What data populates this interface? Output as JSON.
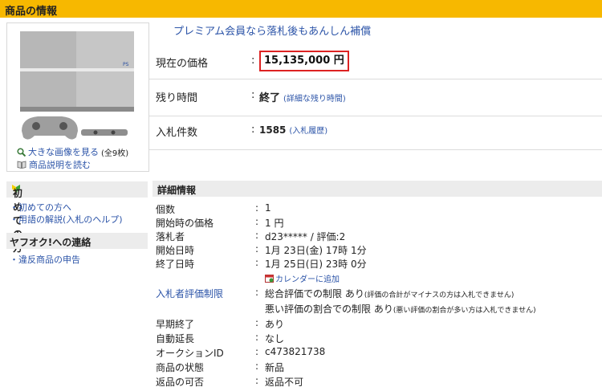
{
  "header": {
    "title": "商品の情報"
  },
  "image_links": {
    "large": "大きな画像を見る",
    "large_count": "(全9枚)",
    "desc": "商品説明を読む"
  },
  "premium": "プレミアム会員なら落札後もあんしん補償",
  "price": {
    "label": "現在の価格",
    "value": "15,135,000 円"
  },
  "time": {
    "label": "残り時間",
    "value": "終了",
    "link": "(詳細な残り時間)"
  },
  "bids": {
    "label": "入札件数",
    "value": "1585",
    "link": "(入札履歴)"
  },
  "sidebar": {
    "beginner_title": "初めての方",
    "beginner_items": [
      "初めての方へ",
      "用語の解説(入札のヘルプ)"
    ],
    "contact_title": "ヤフオク!への連絡",
    "contact_items": [
      "違反商品の申告"
    ]
  },
  "details": {
    "title": "詳細情報",
    "rows": [
      {
        "label": "個数",
        "value": "1"
      },
      {
        "label": "開始時の価格",
        "value": "1 円"
      },
      {
        "label": "落札者",
        "value": "d23***** / 評価:2"
      },
      {
        "label": "開始日時",
        "value": "1月 23日(金) 17時 1分"
      },
      {
        "label": "終了日時",
        "value": "1月 25日(日) 23時 0分"
      }
    ],
    "calendar": "カレンダーに追加",
    "restrict": {
      "label": "入札者評価制限",
      "line1": "総合評価での制限 あり",
      "note1": "(評価の合計がマイナスの方は入札できません)",
      "line2": "悪い評価の割合での制限 あり",
      "note2": "(悪い評価の割合が多い方は入札できません)"
    },
    "rows2": [
      {
        "label": "早期終了",
        "value": "あり"
      },
      {
        "label": "自動延長",
        "value": "なし"
      },
      {
        "label": "オークションID",
        "value": "c473821738"
      },
      {
        "label": "商品の状態",
        "value": "新品"
      },
      {
        "label": "返品の可否",
        "value": "返品不可"
      }
    ]
  }
}
